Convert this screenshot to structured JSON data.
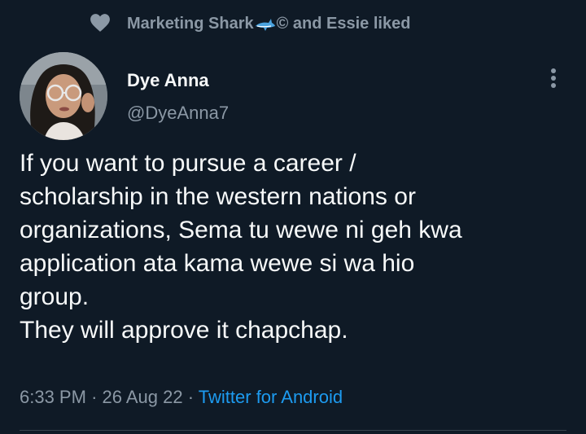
{
  "social_context": {
    "prefix": "Marketing Shark",
    "suffix": "© and Essie liked"
  },
  "author": {
    "display_name": "Dye Anna",
    "handle": "@DyeAnna7"
  },
  "tweet": {
    "lines": [
      "If you want to pursue a career /",
      "scholarship in the western nations or",
      "organizations, Sema tu wewe ni geh kwa",
      "application ata kama wewe si wa hio",
      "group.",
      "They will approve it chapchap."
    ]
  },
  "meta": {
    "time": "6:33 PM",
    "separator": "·",
    "date": "26 Aug 22",
    "source": "Twitter for Android"
  },
  "icons": {
    "heart": "heart-icon",
    "shark": "shark-icon",
    "more": "more-icon"
  },
  "colors": {
    "background": "#0f1a26",
    "primary_text": "#f7f9f9",
    "secondary_text": "#8b98a5",
    "accent": "#1d9bf0"
  }
}
